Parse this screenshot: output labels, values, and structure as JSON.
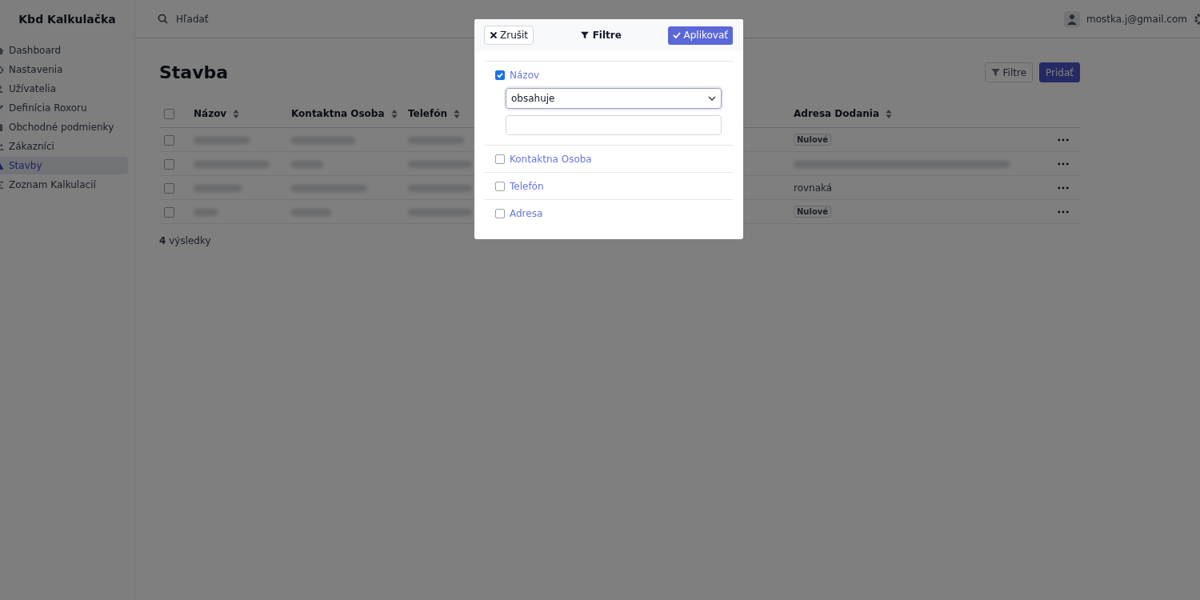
{
  "app": {
    "title": "Kbd Kalkulačka"
  },
  "sidebar": {
    "items": [
      {
        "label": "Dashboard",
        "selected": false
      },
      {
        "label": "Nastavenia",
        "selected": false
      },
      {
        "label": "Užívatelia",
        "selected": false
      },
      {
        "label": "Definícia Roxoru",
        "selected": false
      },
      {
        "label": "Obchodné podmienky",
        "selected": false
      },
      {
        "label": "Zákazníci",
        "selected": false
      },
      {
        "label": "Stavby",
        "selected": true
      },
      {
        "label": "Zoznam Kalkulacií",
        "selected": false
      }
    ]
  },
  "header": {
    "search": {
      "placeholder": "Hľadať"
    },
    "user": "mostka.j@gmail.com"
  },
  "page": {
    "title": "Stavba",
    "buttons": [
      {
        "label": "Filtre",
        "kind": "outline"
      },
      {
        "label": "Pridať",
        "kind": "primary"
      }
    ]
  },
  "table": {
    "all_selected": false,
    "columns": [
      {
        "label": "Názov"
      },
      {
        "label": "Kontaktna Osoba"
      },
      {
        "label": "Telefón"
      },
      {
        "label": "Adresa Dodania"
      }
    ],
    "rows": [
      {
        "selected": false,
        "address": {
          "kind": "badge",
          "text": "Nulové"
        }
      },
      {
        "selected": false,
        "address": {
          "kind": "blurred"
        }
      },
      {
        "selected": false,
        "address": {
          "kind": "text",
          "text": "rovnaká"
        }
      },
      {
        "selected": false,
        "address": {
          "kind": "badge",
          "text": "Nulové"
        }
      }
    ]
  },
  "result_count": "**4** výsledky",
  "filter_dialog": {
    "cancel": "Zrušit",
    "title": "Filtre",
    "apply": "Aplikovať",
    "fields": [
      {
        "label": "Názov",
        "checked": true,
        "operator": "obsahuje"
      },
      {
        "label": "Kontaktna Osoba",
        "checked": false
      },
      {
        "label": "Telefón",
        "checked": false
      },
      {
        "label": "Adresa",
        "checked": false
      }
    ]
  }
}
